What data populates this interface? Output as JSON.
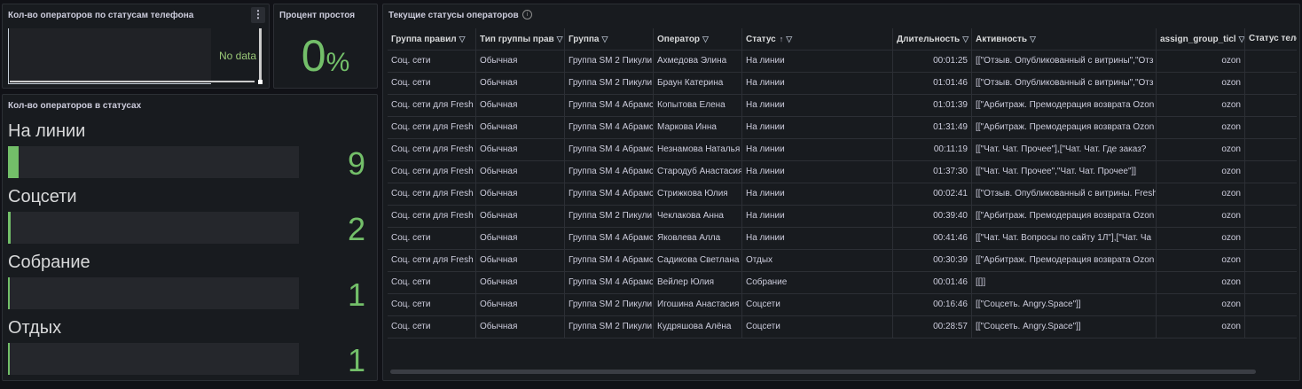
{
  "panel1": {
    "title": "Кол-во операторов по статусам телефона",
    "menu": "⋮",
    "no_data": "No data"
  },
  "panel2": {
    "title": "Процент простоя",
    "value": "0",
    "unit": "%"
  },
  "panel3": {
    "title": "Кол-во операторов в статусах",
    "max": 9,
    "items": [
      {
        "label": "На линии",
        "value": 9
      },
      {
        "label": "Соцсети",
        "value": 2
      },
      {
        "label": "Собрание",
        "value": 1
      },
      {
        "label": "Отдых",
        "value": 1
      }
    ]
  },
  "panel4": {
    "title": "Текущие статусы операторов",
    "info": "i",
    "filter_icon": "▽",
    "sort_icon": "↑",
    "columns": [
      "Группа правил",
      "Тип группы прав",
      "Группа",
      "Оператор",
      "Статус",
      "Длительность",
      "Активность",
      "assign_group_ticl",
      "Статус теле"
    ],
    "rows": [
      [
        "Соц. сети",
        "Обычная",
        "Группа SM 2 Пикули",
        "Ахмедова Элина",
        "На линии",
        "00:01:25",
        "[[\"Отзыв. Опубликованный с витрины\",\"Отз",
        "ozon",
        ""
      ],
      [
        "Соц. сети",
        "Обычная",
        "Группа SM 2 Пикули",
        "Браун Катерина",
        "На линии",
        "01:01:46",
        "[[\"Отзыв. Опубликованный с витрины\",\"Отз",
        "ozon",
        ""
      ],
      [
        "Соц. сети для Fresh",
        "Обычная",
        "Группа SM 4 Абрамс",
        "Копытова Елена",
        "На линии",
        "01:01:39",
        "[[\"Арбитраж. Премодерация возврата Ozon",
        "ozon",
        ""
      ],
      [
        "Соц. сети для Fresh",
        "Обычная",
        "Группа SM 4 Абрамс",
        "Маркова Инна",
        "На линии",
        "01:31:49",
        "[[\"Арбитраж. Премодерация возврата Ozon",
        "ozon",
        ""
      ],
      [
        "Соц. сети для Fresh",
        "Обычная",
        "Группа SM 4 Абрамс",
        "Незнамова Наталья",
        "На линии",
        "00:11:19",
        "[[\"Чат. Чат. Прочее\"],[\"Чат. Чат. Где заказ?",
        "ozon",
        ""
      ],
      [
        "Соц. сети для Fresh",
        "Обычная",
        "Группа SM 4 Абрамс",
        "Стародуб Анастасия",
        "На линии",
        "01:37:30",
        "[[\"Чат. Чат. Прочее\",\"Чат. Чат. Прочее\"]]",
        "ozon",
        ""
      ],
      [
        "Соц. сети для Fresh",
        "Обычная",
        "Группа SM 4 Абрамс",
        "Стрижкова Юлия",
        "На линии",
        "00:02:41",
        "[[\"Отзыв. Опубликованный с витрины. Fresh",
        "ozon",
        ""
      ],
      [
        "Соц. сети для Fresh",
        "Обычная",
        "Группа SM 2 Пикули",
        "Чеклакова Анна",
        "На линии",
        "00:39:40",
        "[[\"Арбитраж. Премодерация возврата Ozon",
        "ozon",
        ""
      ],
      [
        "Соц. сети",
        "Обычная",
        "Группа SM 4 Абрамс",
        "Яковлева Алла",
        "На линии",
        "00:41:46",
        "[[\"Чат. Чат. Вопросы по сайту 1Л\"],[\"Чат. Ча",
        "ozon",
        ""
      ],
      [
        "Соц. сети для Fresh",
        "Обычная",
        "Группа SM 4 Абрамс",
        "Садикова Светлана",
        "Отдых",
        "00:30:39",
        "[[\"Арбитраж. Премодерация возврата Ozon",
        "ozon",
        ""
      ],
      [
        "Соц. сети",
        "Обычная",
        "Группа SM 4 Абрамс",
        "Вейлер Юлия",
        "Собрание",
        "00:01:46",
        "[[]]",
        "ozon",
        ""
      ],
      [
        "Соц. сети",
        "Обычная",
        "Группа SM 2 Пикули",
        "Игошина Анастасия",
        "Соцсети",
        "00:16:46",
        "[[\"Соцсеть. Angry.Space\"]]",
        "ozon",
        ""
      ],
      [
        "Соц. сети",
        "Обычная",
        "Группа SM 2 Пикули",
        "Кудряшова Алёна",
        "Соцсети",
        "00:28:57",
        "[[\"Соцсеть. Angry.Space\"]]",
        "ozon",
        ""
      ]
    ]
  }
}
